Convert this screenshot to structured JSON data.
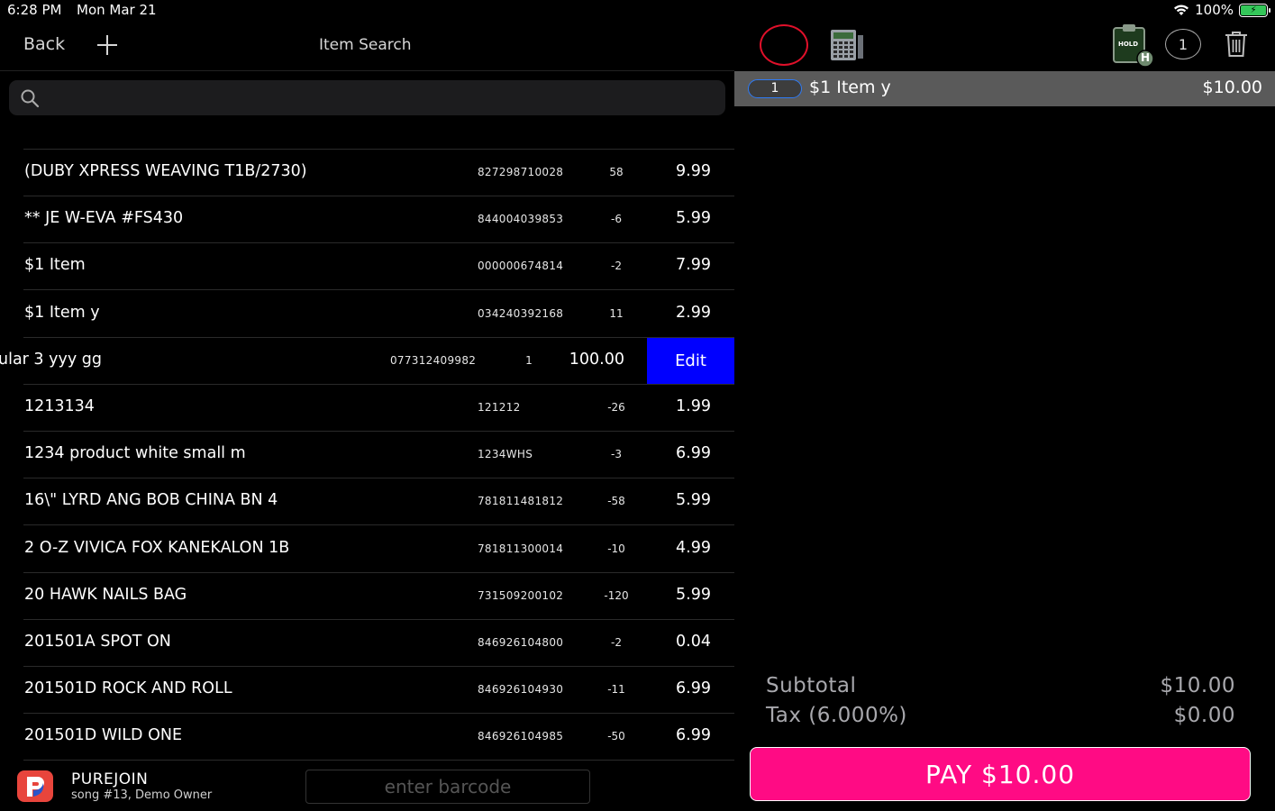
{
  "status_bar": {
    "time": "6:28 PM",
    "date": "Mon Mar 21",
    "battery": "100%",
    "wifi_icon": "wifi-icon",
    "battery_icon": "battery-charging-icon"
  },
  "header": {
    "back_label": "Back",
    "add_icon": "plus-icon",
    "title": "Item Search"
  },
  "search": {
    "placeholder": "",
    "value": ""
  },
  "items": [
    {
      "name": "(DUBY XPRESS WEAVING T1B/2730)",
      "code": "827298710028",
      "qty": "58",
      "price": "9.99"
    },
    {
      "name": "** JE W-EVA #FS430",
      "code": "844004039853",
      "qty": "-6",
      "price": "5.99"
    },
    {
      "name": "$1 Item",
      "code": "000000674814",
      "qty": "-2",
      "price": "7.99"
    },
    {
      "name": "$1 Item y",
      "code": "034240392168",
      "qty": "11",
      "price": "2.99"
    },
    {
      "name": "ular 3 yyy gg",
      "code": "077312409982",
      "qty": "1",
      "price": "100.00",
      "swiped": true
    },
    {
      "name": "1213134",
      "code": "121212",
      "qty": "-26",
      "price": "1.99"
    },
    {
      "name": "1234 product white small m",
      "code": "1234WHS",
      "qty": "-3",
      "price": "6.99"
    },
    {
      "name": "16\\\" LYRD ANG BOB CHINA BN 4",
      "code": "781811481812",
      "qty": "-58",
      "price": "5.99"
    },
    {
      "name": "2 O-Z VIVICA FOX KANEKALON 1B",
      "code": "781811300014",
      "qty": "-10",
      "price": "4.99"
    },
    {
      "name": "20 HAWK NAILS BAG",
      "code": "731509200102",
      "qty": "-120",
      "price": "5.99"
    },
    {
      "name": "201501A SPOT ON",
      "code": "846926104800",
      "qty": "-2",
      "price": "0.04"
    },
    {
      "name": "201501D ROCK AND ROLL",
      "code": "846926104930",
      "qty": "-11",
      "price": "6.99"
    },
    {
      "name": "201501D WILD ONE",
      "code": "846926104985",
      "qty": "-50",
      "price": "6.99"
    }
  ],
  "edit_label": "Edit",
  "footer": {
    "store_name": "PUREJOIN",
    "store_sub": "song #13, Demo Owner",
    "barcode_placeholder": "enter barcode"
  },
  "cart_toolbar": {
    "hold_label": "HOLD",
    "hold_badge": "H",
    "count": "1"
  },
  "cart": {
    "lines": [
      {
        "qty": "1",
        "name": "$1 Item y",
        "price": "$10.00"
      }
    ],
    "subtotal_label": "Subtotal",
    "subtotal_value": "$10.00",
    "tax_label": "Tax (6.000%)",
    "tax_value": "$0.00",
    "pay_label": "PAY $10.00"
  },
  "colors": {
    "pay": "#ff0b84",
    "edit": "#0000ff",
    "accent_red": "#e0102a",
    "qty_outline": "#2f7bf5"
  }
}
